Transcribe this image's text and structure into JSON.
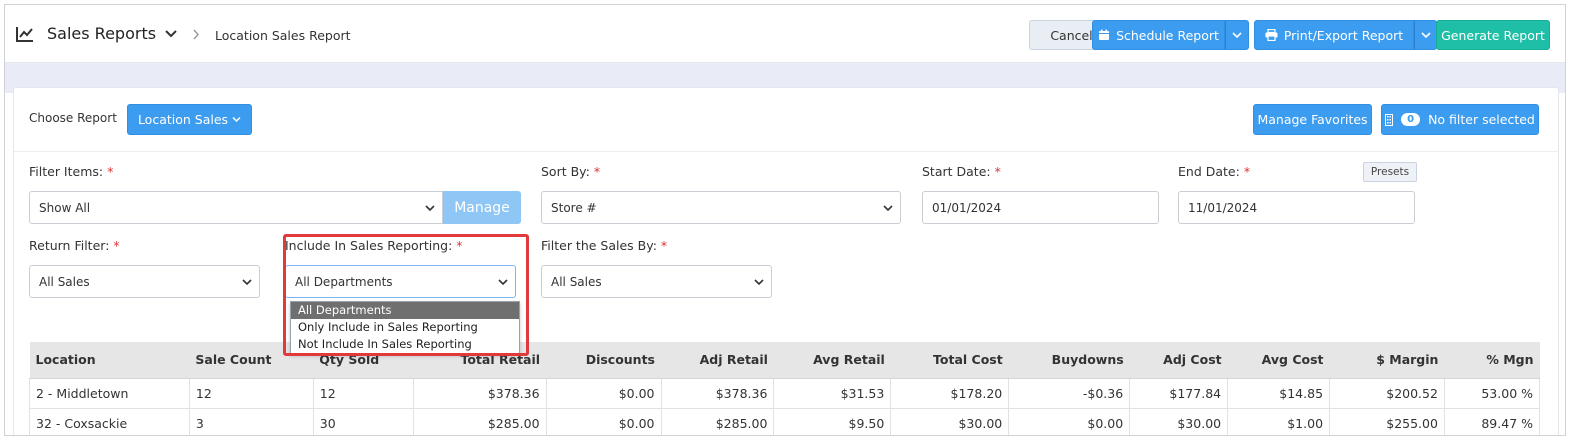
{
  "header": {
    "title": "Sales Reports",
    "breadcrumb_current": "Location Sales Report",
    "cancel_label": "Cancel",
    "schedule_label": "Schedule Report",
    "print_label": "Print/Export Report",
    "generate_label": "Generate Report"
  },
  "toolbar": {
    "choose_label": "Choose Report",
    "report_button": "Location Sales",
    "favorites_label": "Manage Favorites",
    "filter_count": "0",
    "filter_label": "No filter selected"
  },
  "filters": {
    "filter_items": {
      "label": "Filter Items:",
      "value": "Show All",
      "manage_label": "Manage"
    },
    "sort_by": {
      "label": "Sort By:",
      "value": "Store #"
    },
    "start_date": {
      "label": "Start Date:",
      "value": "01/01/2024"
    },
    "end_date": {
      "label": "End Date:",
      "value": "11/01/2024",
      "presets_label": "Presets"
    },
    "return_filter": {
      "label": "Return Filter:",
      "value": "All Sales"
    },
    "include_reporting": {
      "label": "Include In Sales Reporting:",
      "value": "All Departments",
      "options": [
        "All Departments",
        "Only Include in Sales Reporting",
        "Not Include In Sales Reporting"
      ]
    },
    "filter_sales_by": {
      "label": "Filter the Sales By:",
      "value": "All Sales"
    },
    "required_marker": "*"
  },
  "table": {
    "columns": [
      "Location",
      "Sale Count",
      "Qty Sold",
      "Total Retail",
      "Discounts",
      "Adj Retail",
      "Avg Retail",
      "Total Cost",
      "Buydowns",
      "Adj Cost",
      "Avg Cost",
      "$ Margin",
      "% Mgn"
    ],
    "rows": [
      [
        "2 - Middletown",
        "12",
        "12",
        "$378.36",
        "$0.00",
        "$378.36",
        "$31.53",
        "$178.20",
        "-$0.36",
        "$177.84",
        "$14.85",
        "$200.52",
        "53.00 %"
      ],
      [
        "32 - Coxsackie",
        "3",
        "30",
        "$285.00",
        "$0.00",
        "$285.00",
        "$9.50",
        "$30.00",
        "$0.00",
        "$30.00",
        "$1.00",
        "$255.00",
        "89.47 %"
      ]
    ]
  },
  "colors": {
    "primary": "#3c9cf0",
    "success": "#1fbfa7",
    "highlight": "#e03a3a"
  }
}
